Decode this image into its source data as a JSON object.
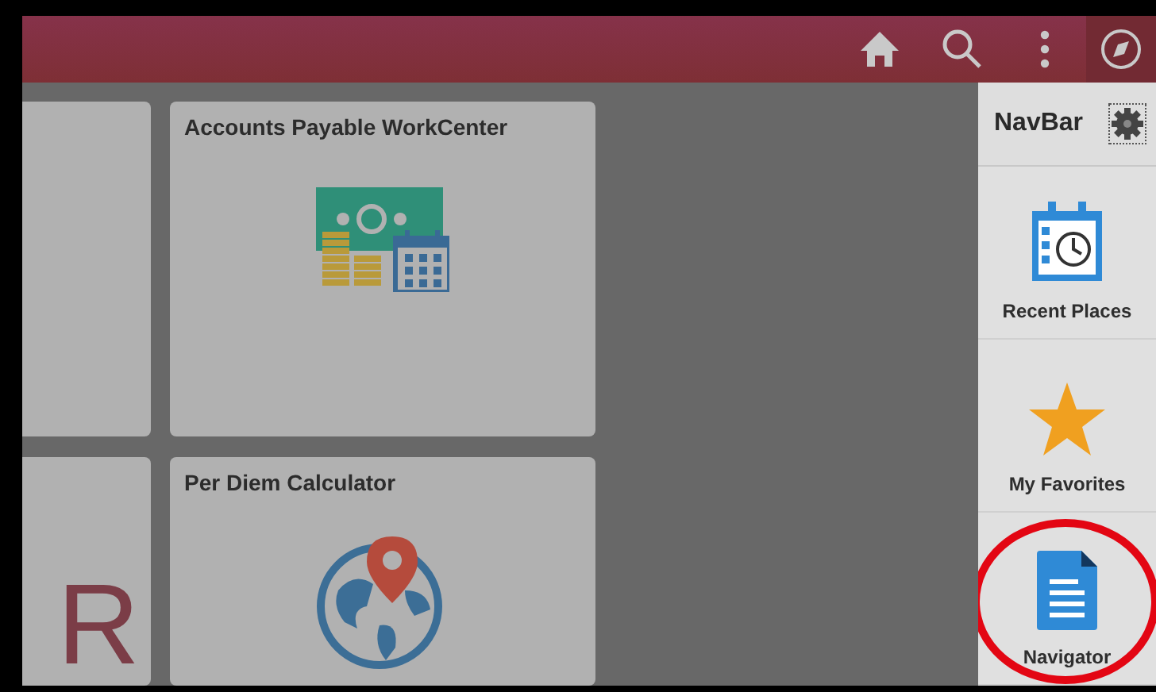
{
  "header": {
    "buttons": [
      {
        "kind": "home"
      },
      {
        "kind": "search"
      },
      {
        "kind": "more"
      },
      {
        "kind": "navbar",
        "selected": true
      }
    ]
  },
  "tiles": [
    {
      "kind": "partial"
    },
    {
      "kind": "tile",
      "title": "Accounts Payable WorkCenter"
    },
    {
      "kind": "partial",
      "logo_text": "R"
    },
    {
      "kind": "tile",
      "title": "Per Diem Calculator"
    }
  ],
  "navbar": {
    "title": "NavBar",
    "items": [
      {
        "label": "Recent Places",
        "highlighted": false
      },
      {
        "label": "My Favorites",
        "highlighted": false
      },
      {
        "label": "Navigator",
        "highlighted": true
      }
    ]
  }
}
